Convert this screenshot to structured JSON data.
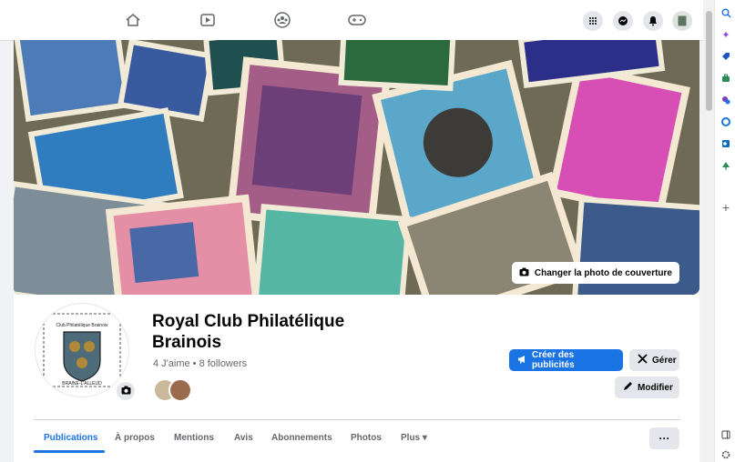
{
  "nav": {
    "icons": [
      "home-icon",
      "watch-icon",
      "groups-icon",
      "gaming-icon"
    ],
    "right_icons": [
      "menu-grid-icon",
      "messenger-icon",
      "notifications-icon",
      "profile-avatar"
    ]
  },
  "cover": {
    "change_photo_label": "Changer la photo de couverture"
  },
  "page": {
    "name": "Royal Club Philatélique Brainois",
    "stats": "4 J'aime • 8 followers",
    "logo_top_text": "Club Philatélique Brainois",
    "logo_bottom_text": "BRAINE-L'ALLEUD"
  },
  "actions": {
    "create_ads": "Créer des publicités",
    "manage": "Gérer",
    "edit": "Modifier"
  },
  "tabs": [
    {
      "label": "Publications",
      "active": true
    },
    {
      "label": "À propos"
    },
    {
      "label": "Mentions"
    },
    {
      "label": "Avis"
    },
    {
      "label": "Abonnements"
    },
    {
      "label": "Photos"
    },
    {
      "label": "Plus ▾"
    }
  ],
  "more_label": "···",
  "colors": {
    "accent": "#1b74e4",
    "background": "#f0f2f5",
    "text_secondary": "#65676b"
  }
}
